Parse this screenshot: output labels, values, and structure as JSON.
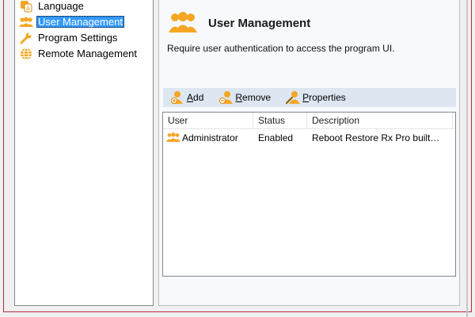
{
  "tree": {
    "items": [
      {
        "label": "Language",
        "icon": "language-icon"
      },
      {
        "label": "User Management",
        "icon": "users-icon",
        "selected": true
      },
      {
        "label": "Program Settings",
        "icon": "wrench-icon"
      },
      {
        "label": "Remote Management",
        "icon": "globe-icon"
      }
    ]
  },
  "panel": {
    "title": "User Management",
    "description": "Require user authentication to access the program UI."
  },
  "toolbar": {
    "add": {
      "first": "A",
      "rest": "dd"
    },
    "remove": {
      "first": "R",
      "rest": "emove"
    },
    "properties": {
      "first": "P",
      "rest": "roperties"
    }
  },
  "table": {
    "columns": [
      "User",
      "Status",
      "Description"
    ],
    "rows": [
      {
        "user": "Administrator",
        "status": "Enabled",
        "description": "Reboot Restore Rx Pro built…"
      }
    ]
  },
  "colors": {
    "accent": "#f5a623",
    "selection": "#3399ff",
    "frame": "#b12e3c"
  }
}
